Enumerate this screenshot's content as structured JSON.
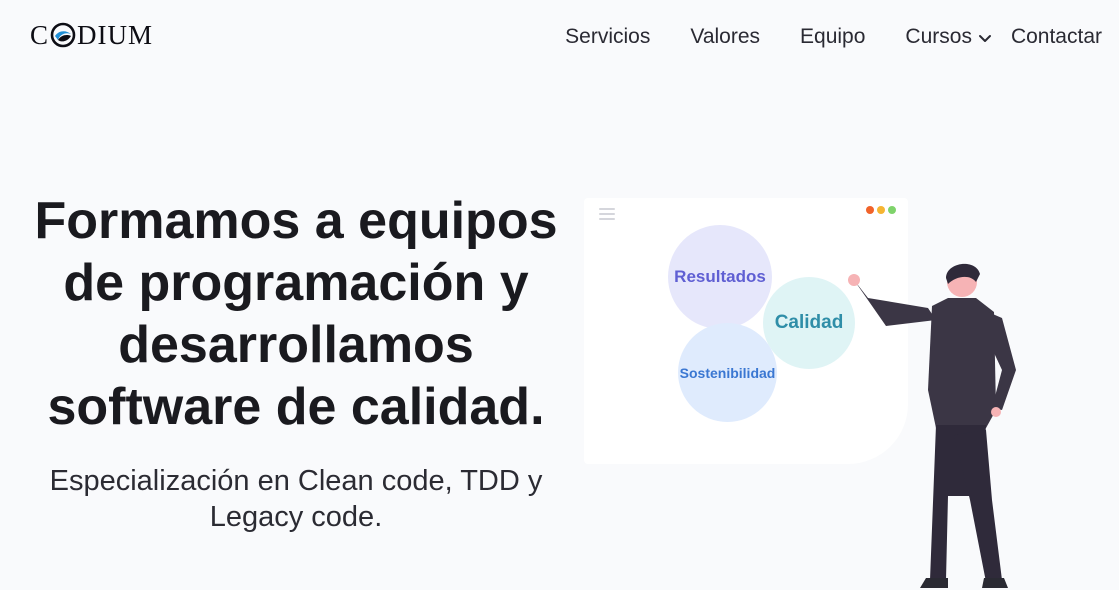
{
  "brand": {
    "name": "CODIUM",
    "prefix": "C",
    "suffix": "DIUM"
  },
  "nav": {
    "items": [
      "Servicios",
      "Valores",
      "Equipo"
    ],
    "dropdown_label": "Cursos",
    "contact_label": "Contactar"
  },
  "hero": {
    "title": "Formamos a equipos de programación y desarrollamos software de calidad.",
    "subtitle": "Especialización en Clean code, TDD y Legacy code."
  },
  "illustration": {
    "bubbles": {
      "results": "Resultados",
      "quality": "Calidad",
      "sustainability": "Sostenibilidad"
    },
    "window_dots_colors": [
      "#f1632a",
      "#f6b532",
      "#7fd36b"
    ]
  },
  "colors": {
    "background": "#f9fafc",
    "text": "#1a1a1f",
    "person_dark": "#3b3645"
  }
}
